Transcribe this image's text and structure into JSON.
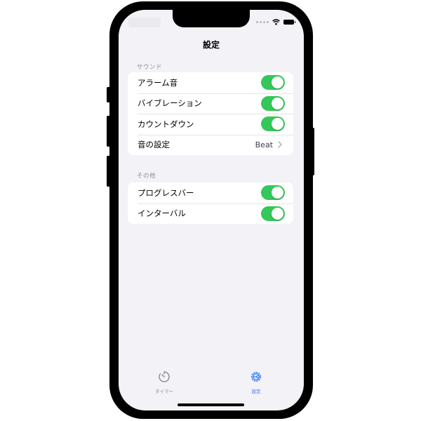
{
  "nav": {
    "title": "設定"
  },
  "sections": [
    {
      "header": "サウンド",
      "rows": [
        {
          "label": "アラーム音",
          "type": "toggle",
          "on": true
        },
        {
          "label": "バイブレーション",
          "type": "toggle",
          "on": true
        },
        {
          "label": "カウントダウン",
          "type": "toggle",
          "on": true
        },
        {
          "label": "音の設定",
          "type": "disclosure",
          "value": "Beat"
        }
      ]
    },
    {
      "header": "その他",
      "rows": [
        {
          "label": "プログレスバー",
          "type": "toggle",
          "on": true
        },
        {
          "label": "インターバル",
          "type": "toggle",
          "on": true
        }
      ]
    }
  ],
  "tabs": [
    {
      "label": "タイマー",
      "icon": "timer-icon",
      "selected": false
    },
    {
      "label": "設定",
      "icon": "gear-icon",
      "selected": true
    }
  ],
  "colors": {
    "toggle_on": "#34c759",
    "accent": "#3478f6",
    "background": "#f2f2f7",
    "inactive": "#8e8e93"
  }
}
